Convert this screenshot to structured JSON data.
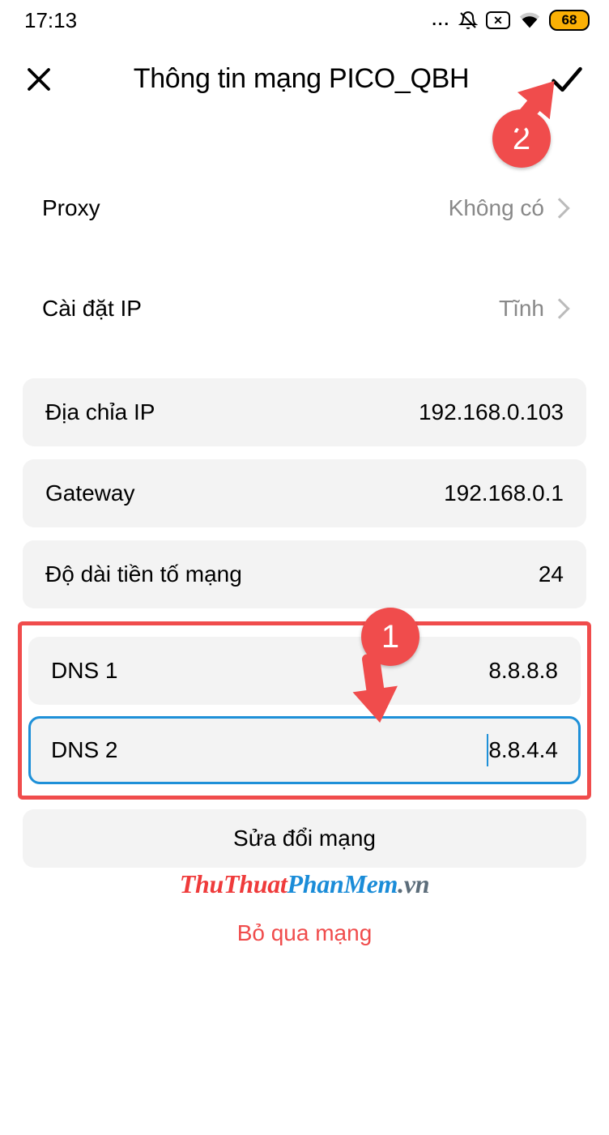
{
  "status": {
    "time": "17:13",
    "battery": "68"
  },
  "header": {
    "title": "Thông tin mạng PICO_QBH"
  },
  "settings": {
    "proxy_label": "Proxy",
    "proxy_value": "Không có",
    "ip_settings_label": "Cài đặt IP",
    "ip_settings_value": "Tĩnh"
  },
  "fields": {
    "ip_label": "Địa chỉa IP",
    "ip_value": "192.168.0.103",
    "gateway_label": "Gateway",
    "gateway_value": "192.168.0.1",
    "prefix_label": "Độ dài tiền tố mạng",
    "prefix_value": "24",
    "dns1_label": "DNS 1",
    "dns1_value": "8.8.8.8",
    "dns2_label": "DNS 2",
    "dns2_value": "8.8.4.4"
  },
  "actions": {
    "modify": "Sửa đổi mạng",
    "forget": "Bỏ qua mạng"
  },
  "watermark": {
    "p1": "ThuThuat",
    "p2": "PhanMem",
    "p3": ".vn"
  },
  "annotations": {
    "step1": "1",
    "step2": "2"
  }
}
